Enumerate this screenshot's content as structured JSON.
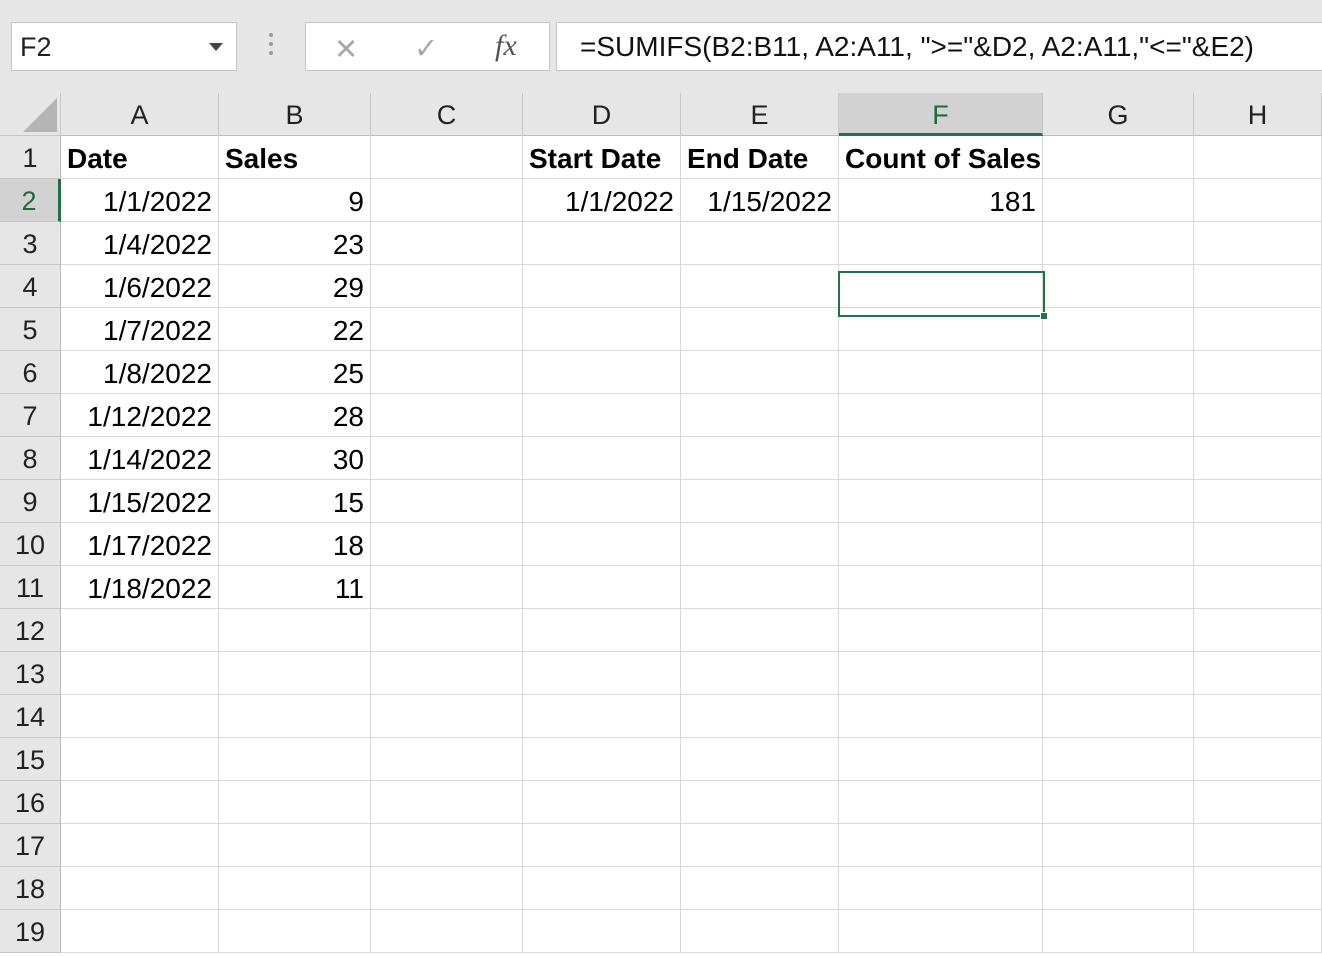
{
  "formula_bar": {
    "name_box": "F2",
    "cancel_glyph": "✕",
    "enter_glyph": "✓",
    "fx_label": "fx",
    "formula": "=SUMIFS(B2:B11, A2:A11, \">=\"&D2, A2:A11,\"<=\"&E2)"
  },
  "sheet": {
    "columns": [
      "A",
      "B",
      "C",
      "D",
      "E",
      "F",
      "G",
      "H"
    ],
    "rows": [
      "1",
      "2",
      "3",
      "4",
      "5",
      "6",
      "7",
      "8",
      "9",
      "10",
      "11",
      "12",
      "13",
      "14",
      "15",
      "16",
      "17",
      "18",
      "19"
    ],
    "active_cell": "F2",
    "headers": {
      "A1": "Date",
      "B1": "Sales",
      "D1": "Start Date",
      "E1": "End Date",
      "F1": "Count of Sales"
    },
    "data": [
      {
        "date": "1/1/2022",
        "sales": "9"
      },
      {
        "date": "1/4/2022",
        "sales": "23"
      },
      {
        "date": "1/6/2022",
        "sales": "29"
      },
      {
        "date": "1/7/2022",
        "sales": "22"
      },
      {
        "date": "1/8/2022",
        "sales": "25"
      },
      {
        "date": "1/12/2022",
        "sales": "28"
      },
      {
        "date": "1/14/2022",
        "sales": "30"
      },
      {
        "date": "1/15/2022",
        "sales": "15"
      },
      {
        "date": "1/17/2022",
        "sales": "18"
      },
      {
        "date": "1/18/2022",
        "sales": "11"
      }
    ],
    "D2": "1/1/2022",
    "E2": "1/15/2022",
    "F2": "181"
  },
  "colors": {
    "accent": "#217346",
    "header_bg": "#e6e6e6",
    "gridline": "#d9d9d9"
  }
}
